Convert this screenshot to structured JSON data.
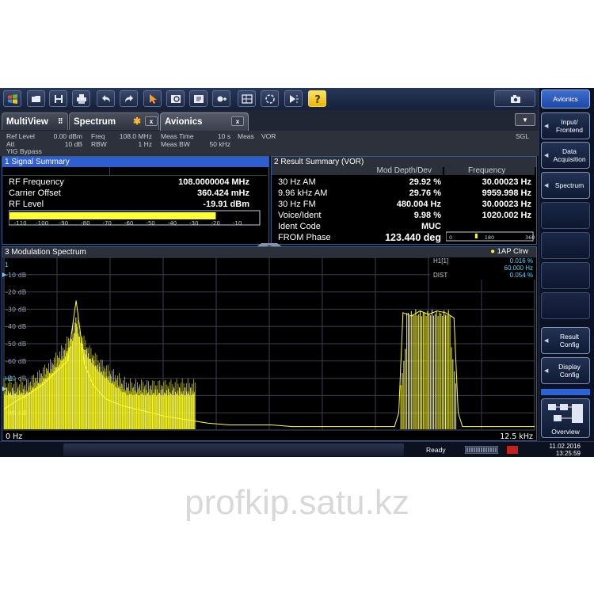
{
  "toolbar": {
    "icons": [
      "windows-logo-icon",
      "open-folder-icon",
      "save-icon",
      "print-icon",
      "undo-icon",
      "redo-icon",
      "select-cursor-icon",
      "marker-zoom-icon",
      "zoom-in-icon",
      "multi-marker-icon",
      "overview-table-icon",
      "copy-traces-icon",
      "sequencer-icon",
      "help-icon",
      "screenshot-camera-icon"
    ]
  },
  "right_panel": {
    "avionics": "Avionics",
    "input_frontend": "Input/ Frontend",
    "data_acquisition": "Data Acquisition",
    "spectrum": "Spectrum",
    "result_config": "Result Config",
    "display_config": "Display Config",
    "overview": "Overview"
  },
  "tabs": {
    "multiview": "MultiView",
    "spectrum": "Spectrum",
    "avionics": "Avionics",
    "close": "x"
  },
  "info": {
    "ref_level_label": "Ref Level",
    "ref_level_value": "0.00 dBm",
    "att_label": "Att",
    "att_value": "10 dB",
    "yig_bypass": "YIG Bypass",
    "freq_label": "Freq",
    "freq_value": "108.0 MHz",
    "rbw_label": "RBW",
    "rbw_value": "1 Hz",
    "meas_time_label": "Meas Time",
    "meas_time_value": "10 s",
    "meas_bw_label": "Meas BW",
    "meas_bw_value": "50 kHz",
    "meas_label": "Meas",
    "meas_value": "VOR",
    "sgl": "SGL"
  },
  "signal_summary": {
    "title": "1 Signal Summary",
    "rows": [
      {
        "label": "RF Frequency",
        "value": "108.0000004 MHz"
      },
      {
        "label": "Carrier Offset",
        "value": "360.424 mHz"
      },
      {
        "label": "RF Level",
        "value": "-19.91 dBm"
      }
    ],
    "bar_scale": [
      "-110",
      "-100",
      "-90",
      "-80",
      "-70",
      "-60",
      "-50",
      "-40",
      "-30",
      "-20",
      "-10"
    ],
    "rf_level_dbm": -19.91,
    "bar_range": [
      -115,
      0
    ]
  },
  "result_summary": {
    "title": "2 Result Summary (VOR)",
    "col_mod": "Mod Depth/Dev",
    "col_freq": "Frequency",
    "rows": [
      {
        "label": "30 Hz AM",
        "mod": "29.92 %",
        "freq": "30.00023 Hz"
      },
      {
        "label": "9.96 kHz AM",
        "mod": "29.76 %",
        "freq": "9959.998 Hz"
      },
      {
        "label": "30 Hz FM",
        "mod": "480.004 Hz",
        "freq": "30.00023 Hz"
      },
      {
        "label": "Voice/Ident",
        "mod": "9.98 %",
        "freq": "1020.002 Hz"
      },
      {
        "label": "Ident Code",
        "mod": "MUC",
        "freq": ""
      },
      {
        "label": "FROM Phase",
        "mod": "123.440 deg",
        "freq": ""
      }
    ],
    "phase_scale": [
      "0",
      "180",
      "360"
    ],
    "phase_deg": 123.44
  },
  "mod_spectrum": {
    "title": "3 Modulation Spectrum",
    "trace": "1AP Clrw",
    "marker_label": "1",
    "marker_h1": "H1[1]",
    "marker_h1_val1": "0.016 %",
    "marker_h1_val2": "60.000 Hz",
    "marker_dist": "DIST",
    "marker_dist_val": "0.054 %",
    "marker_bottom": "H1"
  },
  "chart_data": {
    "type": "line",
    "title": "3 Modulation Spectrum",
    "xlabel": "",
    "ylabel": "",
    "xlim": [
      0,
      12.5
    ],
    "ylim": [
      -100,
      0
    ],
    "x_unit": "kHz",
    "x_tick_labels": [
      "0 Hz",
      "12.5 kHz"
    ],
    "y_ticks": [
      -10,
      -20,
      -30,
      -40,
      -50,
      -60,
      -70,
      -80,
      -90
    ],
    "y_tick_labels": [
      "-10 dB",
      "-20 dB",
      "-30 dB",
      "-40 dB",
      "-50 dB",
      "-60 dB",
      "-70 dB",
      "-80 dB",
      "-90 dB"
    ],
    "grid": true,
    "series": [
      {
        "x": [
          0,
          0.3,
          0.6,
          0.9,
          1.2,
          1.5,
          1.7,
          1.9,
          2.1,
          2.4,
          2.8,
          3.3,
          3.8,
          4.3,
          4.8,
          5.3,
          5.8,
          6.3,
          6.8,
          7.3,
          7.8,
          8.3,
          8.8,
          9.2,
          9.3,
          9.4,
          9.6,
          9.8,
          10.0,
          10.2,
          10.4,
          10.6,
          10.7,
          10.8,
          11.2,
          11.6,
          12.0,
          12.5
        ],
        "y": [
          -88,
          -83,
          -79,
          -74,
          -67,
          -60,
          -25,
          -62,
          -74,
          -82,
          -86,
          -89,
          -92,
          -94,
          -96,
          -97,
          -97,
          -97,
          -98,
          -98,
          -98,
          -98,
          -98,
          -98,
          -90,
          -32,
          -34,
          -31,
          -33,
          -31,
          -32,
          -35,
          -90,
          -98,
          -98,
          -98,
          -98,
          -98
        ]
      }
    ],
    "band_start_khz": 9.35,
    "band_end_khz": 10.65,
    "band_peak_db": -30
  }
}
